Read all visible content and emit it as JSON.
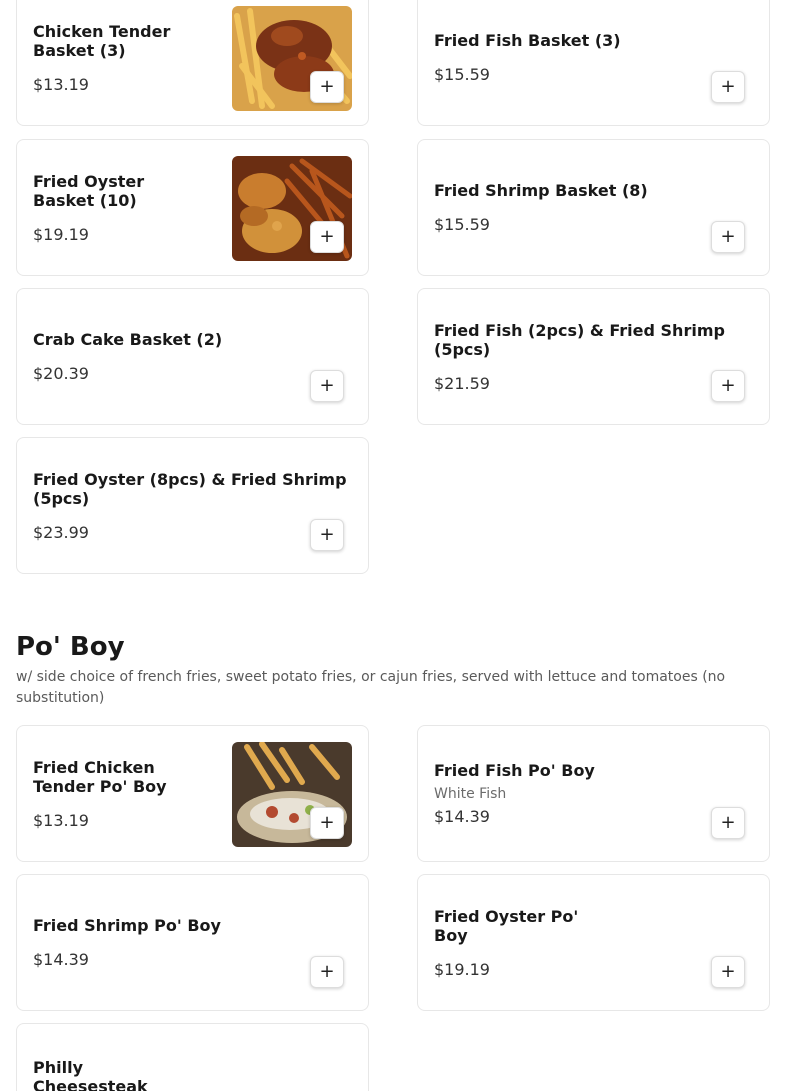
{
  "baskets": [
    {
      "name": "Chicken Tender Basket (3)",
      "price": "$13.19"
    },
    {
      "name": "Fried Fish Basket (3)",
      "price": "$15.59"
    },
    {
      "name": "Fried Oyster Basket (10)",
      "price": "$19.19"
    },
    {
      "name": "Fried Shrimp Basket (8)",
      "price": "$15.59"
    },
    {
      "name": "Crab Cake Basket (2)",
      "price": "$20.39"
    },
    {
      "name": "Fried Fish (2pcs) & Fried Shrimp (5pcs)",
      "price": "$21.59"
    },
    {
      "name": "Fried Oyster (8pcs) & Fried Shrimp (5pcs)",
      "price": "$23.99"
    }
  ],
  "poboy": {
    "title": "Po' Boy",
    "description": "w/ side choice of french fries, sweet potato fries, or cajun fries, served with lettuce and tomatoes (no substitution)",
    "items": [
      {
        "name": "Fried Chicken Tender Po' Boy",
        "price": "$13.19"
      },
      {
        "name": "Fried Fish Po' Boy",
        "description": "White Fish",
        "price": "$14.39"
      },
      {
        "name": "Fried Shrimp Po' Boy",
        "price": "$14.39"
      },
      {
        "name": "Fried Oyster Po' Boy",
        "price": "$19.19"
      },
      {
        "name": "Philly Cheesesteak"
      }
    ]
  },
  "add_symbol": "+",
  "icons": {
    "add": "plus-icon"
  }
}
